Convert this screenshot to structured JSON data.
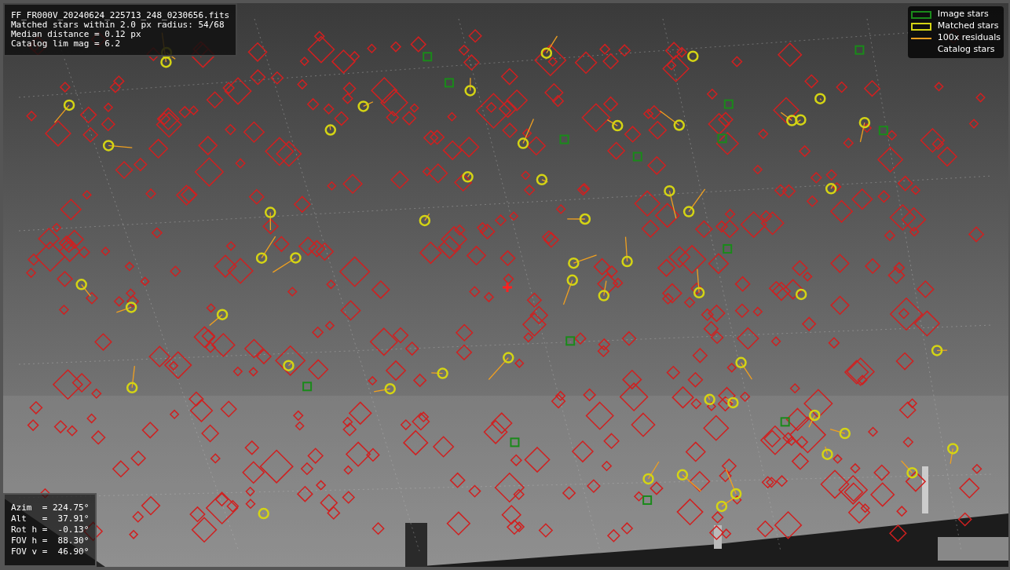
{
  "info_panel": {
    "lines": [
      "FF_FR000V_20240624_225713_248_0230656.fits",
      "Matched stars within 2.0 px radius: 54/68",
      "Median distance = 0.12 px",
      "Catalog lim mag = 6.2"
    ]
  },
  "legend": [
    {
      "label": "Image stars",
      "color": "#1a8a1a"
    },
    {
      "kind": "matched",
      "label": "Matched stars",
      "color": "#d4d414"
    },
    {
      "kind": "residual",
      "label": "100x residuals",
      "color": "#f0a020"
    },
    {
      "kind": "catalog",
      "label": "Catalog stars",
      "color": "#d02020"
    }
  ],
  "pointing_panel": {
    "lines": [
      "Azim  = 224.75°",
      "Alt   =  37.91°",
      "Rot h =  -0.13°",
      "FOV h =  88.30°",
      "FOV v =  46.90°"
    ]
  }
}
